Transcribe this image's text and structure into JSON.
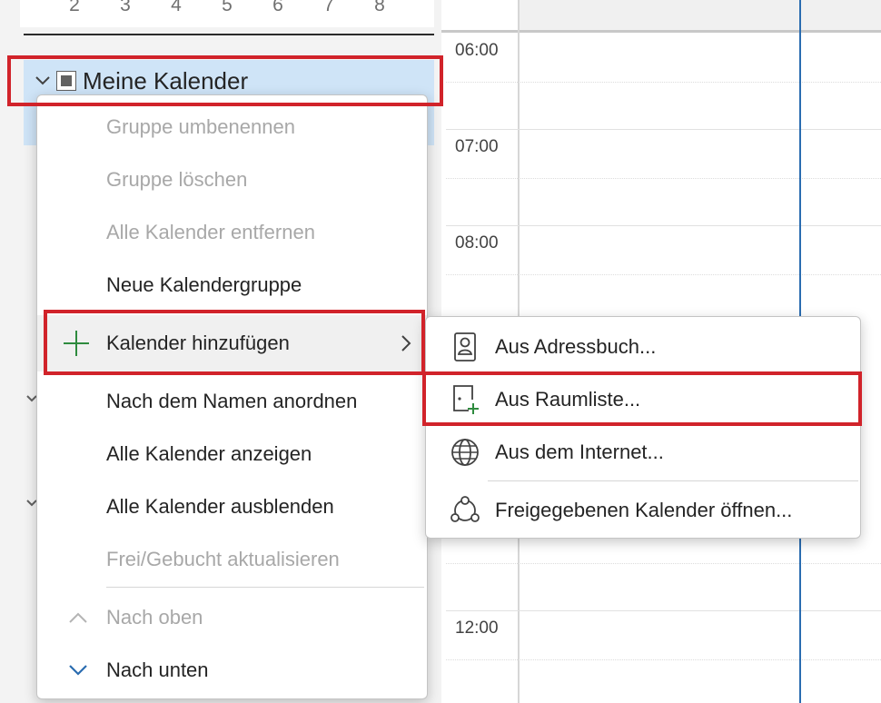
{
  "mini_calendar": {
    "days": [
      "2",
      "3",
      "4",
      "5",
      "6",
      "7",
      "8"
    ]
  },
  "calendar_group": {
    "label": "Meine Kalender"
  },
  "time_slots": [
    "06:00",
    "07:00",
    "08:00",
    "12:00"
  ],
  "context_menu": {
    "items": [
      {
        "label": "Gruppe umbenennen",
        "enabled": false
      },
      {
        "label": "Gruppe löschen",
        "enabled": false
      },
      {
        "label": "Alle Kalender entfernen",
        "enabled": false
      },
      {
        "label": "Neue Kalendergruppe",
        "enabled": true
      },
      {
        "label": "Kalender hinzufügen",
        "enabled": true,
        "icon": "plus-icon",
        "has_submenu": true
      },
      {
        "label": "Nach dem Namen anordnen",
        "enabled": true
      },
      {
        "label": "Alle Kalender anzeigen",
        "enabled": true
      },
      {
        "label": "Alle Kalender ausblenden",
        "enabled": true
      },
      {
        "label": "Frei/Gebucht aktualisieren",
        "enabled": false
      },
      {
        "label": "Nach oben",
        "enabled": false,
        "icon": "chevron-up-icon"
      },
      {
        "label": "Nach unten",
        "enabled": true,
        "icon": "chevron-down-icon"
      }
    ]
  },
  "submenu": {
    "items": [
      {
        "label": "Aus Adressbuch...",
        "icon": "address-book-icon"
      },
      {
        "label": "Aus Raumliste...",
        "icon": "room-list-icon"
      },
      {
        "label": "Aus dem Internet...",
        "icon": "globe-icon"
      },
      {
        "label": "Freigegebenen Kalender öffnen...",
        "icon": "shared-calendar-icon"
      }
    ]
  },
  "colors": {
    "highlight_red": "#d1232a",
    "selection_blue": "#cfe4f7",
    "accent_blue": "#2a6cb0",
    "plus_green": "#2e8b3e"
  }
}
